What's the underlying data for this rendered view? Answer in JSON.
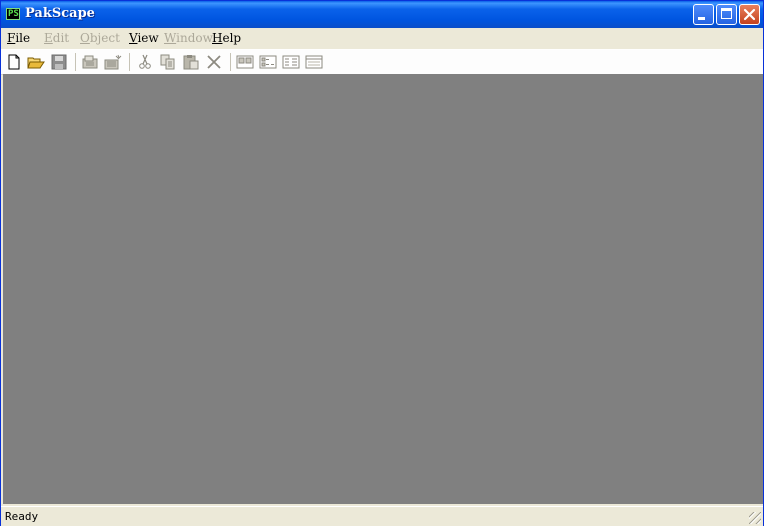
{
  "window": {
    "title": "PakScape"
  },
  "app_icon_label": "PS",
  "menu": [
    {
      "label": "File",
      "accel": "F",
      "rest": "ile",
      "enabled": true
    },
    {
      "label": "Edit",
      "accel": "E",
      "rest": "dit",
      "enabled": false
    },
    {
      "label": "Object",
      "accel": "O",
      "rest": "bject",
      "enabled": false
    },
    {
      "label": "View",
      "accel": "V",
      "rest": "iew",
      "enabled": true
    },
    {
      "label": "Window",
      "accel": "W",
      "rest": "indow",
      "enabled": false
    },
    {
      "label": "Help",
      "accel": "H",
      "rest": "elp",
      "enabled": true
    }
  ],
  "toolbar": [
    {
      "icon": "new-file-icon",
      "enabled": true
    },
    {
      "icon": "open-folder-icon",
      "enabled": true
    },
    {
      "icon": "save-icon",
      "enabled": false
    },
    {
      "icon": "add-files-icon",
      "enabled": false
    },
    {
      "icon": "add-folder-icon",
      "enabled": false
    },
    {
      "icon": "cut-icon",
      "enabled": false
    },
    {
      "icon": "copy-icon",
      "enabled": false
    },
    {
      "icon": "paste-icon",
      "enabled": false
    },
    {
      "icon": "delete-icon",
      "enabled": false
    },
    {
      "icon": "large-icons-view-icon",
      "enabled": false
    },
    {
      "icon": "small-icons-view-icon",
      "enabled": false
    },
    {
      "icon": "list-view-icon",
      "enabled": false
    },
    {
      "icon": "details-view-icon",
      "enabled": false
    }
  ],
  "statusbar": {
    "text": "Ready"
  },
  "colors": {
    "titlebar": "#0055e0",
    "workspace": "#808080",
    "chrome": "#ece9d8",
    "disabled": "#aca899"
  }
}
